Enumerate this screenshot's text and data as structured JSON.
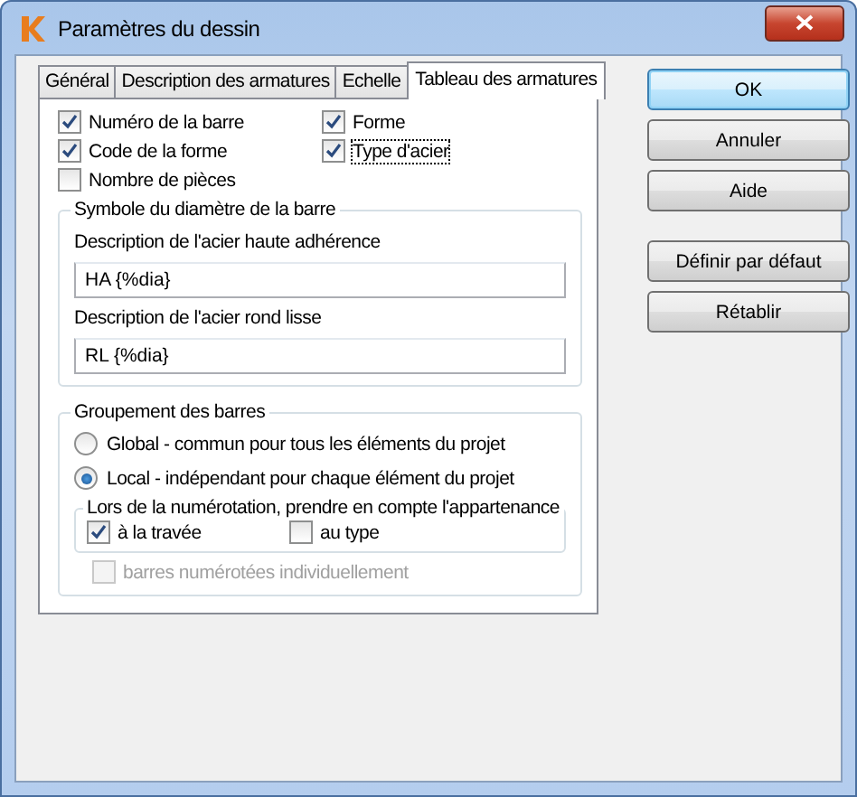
{
  "window": {
    "title": "Paramètres du dessin"
  },
  "tabs": [
    {
      "label": "Général",
      "selected": false
    },
    {
      "label": "Description des armatures",
      "selected": false
    },
    {
      "label": "Echelle",
      "selected": false
    },
    {
      "label": "Tableau des armatures",
      "selected": true
    }
  ],
  "columns": [
    {
      "label": "Numéro de la barre",
      "checked": true,
      "focused": false
    },
    {
      "label": "Forme",
      "checked": true,
      "focused": false
    },
    {
      "label": "Code de la forme",
      "checked": true,
      "focused": false
    },
    {
      "label": "Type d'acier",
      "checked": true,
      "focused": true
    },
    {
      "label": "Nombre de pièces",
      "checked": false,
      "focused": false
    }
  ],
  "diameter_symbol": {
    "title": "Symbole du diamètre de la barre",
    "fields": [
      {
        "label": "Description de l'acier haute adhérence",
        "value": "HA {%dia}"
      },
      {
        "label": "Description de l'acier rond lisse",
        "value": "RL {%dia}"
      }
    ]
  },
  "grouping": {
    "title": "Groupement des barres",
    "options": [
      {
        "label": "Global - commun pour tous les éléments du projet",
        "selected": false
      },
      {
        "label": "Local - indépendant pour chaque élément du projet",
        "selected": true
      }
    ],
    "numbering": {
      "title": "Lors de la numérotation, prendre en compte l'appartenance",
      "options": [
        {
          "label": "à la travée",
          "checked": true
        },
        {
          "label": "au type",
          "checked": false
        }
      ]
    },
    "individual": {
      "label": "barres numérotées individuellement",
      "checked": false,
      "disabled": true
    }
  },
  "buttons": [
    {
      "label": "OK",
      "default": true
    },
    {
      "label": "Annuler",
      "default": false
    },
    {
      "label": "Aide",
      "default": false
    }
  ],
  "secondary_buttons": [
    {
      "label": "Définir par défaut"
    },
    {
      "label": "Rétablir"
    }
  ]
}
